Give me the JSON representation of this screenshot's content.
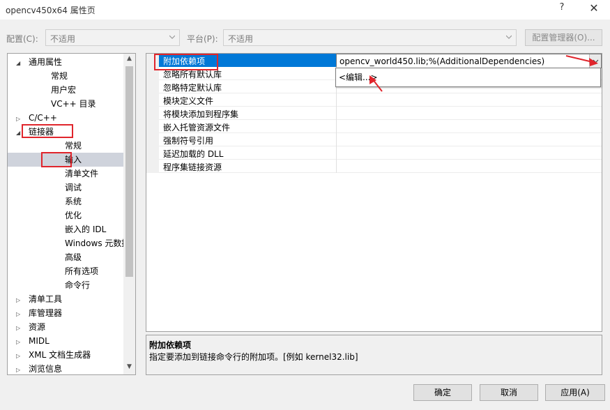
{
  "window": {
    "title": "opencv450x64 属性页",
    "help_label": "?",
    "close_label": "✕"
  },
  "config": {
    "config_label": "配置(C):",
    "config_value": "不适用",
    "platform_label": "平台(P):",
    "platform_value": "不适用",
    "manager_label": "配置管理器(O)..."
  },
  "tree": [
    {
      "label": "通用属性",
      "exp": "◢",
      "indent": 0
    },
    {
      "label": "常规",
      "exp": "",
      "indent": 1
    },
    {
      "label": "用户宏",
      "exp": "",
      "indent": 1
    },
    {
      "label": "VC++ 目录",
      "exp": "",
      "indent": 1
    },
    {
      "label": "C/C++",
      "exp": "▷",
      "indent": 0
    },
    {
      "label": "链接器",
      "exp": "◢",
      "indent": 0
    },
    {
      "label": "常规",
      "exp": "",
      "indent": 2
    },
    {
      "label": "输入",
      "exp": "",
      "indent": 2,
      "selected": true
    },
    {
      "label": "清单文件",
      "exp": "",
      "indent": 2
    },
    {
      "label": "调试",
      "exp": "",
      "indent": 2
    },
    {
      "label": "系统",
      "exp": "",
      "indent": 2
    },
    {
      "label": "优化",
      "exp": "",
      "indent": 2
    },
    {
      "label": "嵌入的 IDL",
      "exp": "",
      "indent": 2
    },
    {
      "label": "Windows 元数据",
      "exp": "",
      "indent": 2
    },
    {
      "label": "高级",
      "exp": "",
      "indent": 2
    },
    {
      "label": "所有选项",
      "exp": "",
      "indent": 2
    },
    {
      "label": "命令行",
      "exp": "",
      "indent": 2
    },
    {
      "label": "清单工具",
      "exp": "▷",
      "indent": 0
    },
    {
      "label": "库管理器",
      "exp": "▷",
      "indent": 0
    },
    {
      "label": "资源",
      "exp": "▷",
      "indent": 0
    },
    {
      "label": "MIDL",
      "exp": "▷",
      "indent": 0
    },
    {
      "label": "XML 文档生成器",
      "exp": "▷",
      "indent": 0
    },
    {
      "label": "浏览信息",
      "exp": "▷",
      "indent": 0
    }
  ],
  "properties": [
    {
      "name": "附加依赖项",
      "value": "opencv_world450.lib;%(AdditionalDependencies)",
      "active": true
    },
    {
      "name": "忽略所有默认库",
      "value": ""
    },
    {
      "name": "忽略特定默认库",
      "value": ""
    },
    {
      "name": "模块定义文件",
      "value": ""
    },
    {
      "name": "将模块添加到程序集",
      "value": ""
    },
    {
      "name": "嵌入托管资源文件",
      "value": ""
    },
    {
      "name": "强制符号引用",
      "value": ""
    },
    {
      "name": "延迟加载的 DLL",
      "value": ""
    },
    {
      "name": "程序集链接资源",
      "value": ""
    }
  ],
  "dropdown": {
    "option": "<编辑...>"
  },
  "description": {
    "title": "附加依赖项",
    "text": "指定要添加到链接命令行的附加项。[例如 kernel32.lib]"
  },
  "buttons": {
    "ok": "确定",
    "cancel": "取消",
    "apply": "应用(A)"
  },
  "colors": {
    "selection": "#0078d7",
    "annotation": "#e0252c"
  }
}
